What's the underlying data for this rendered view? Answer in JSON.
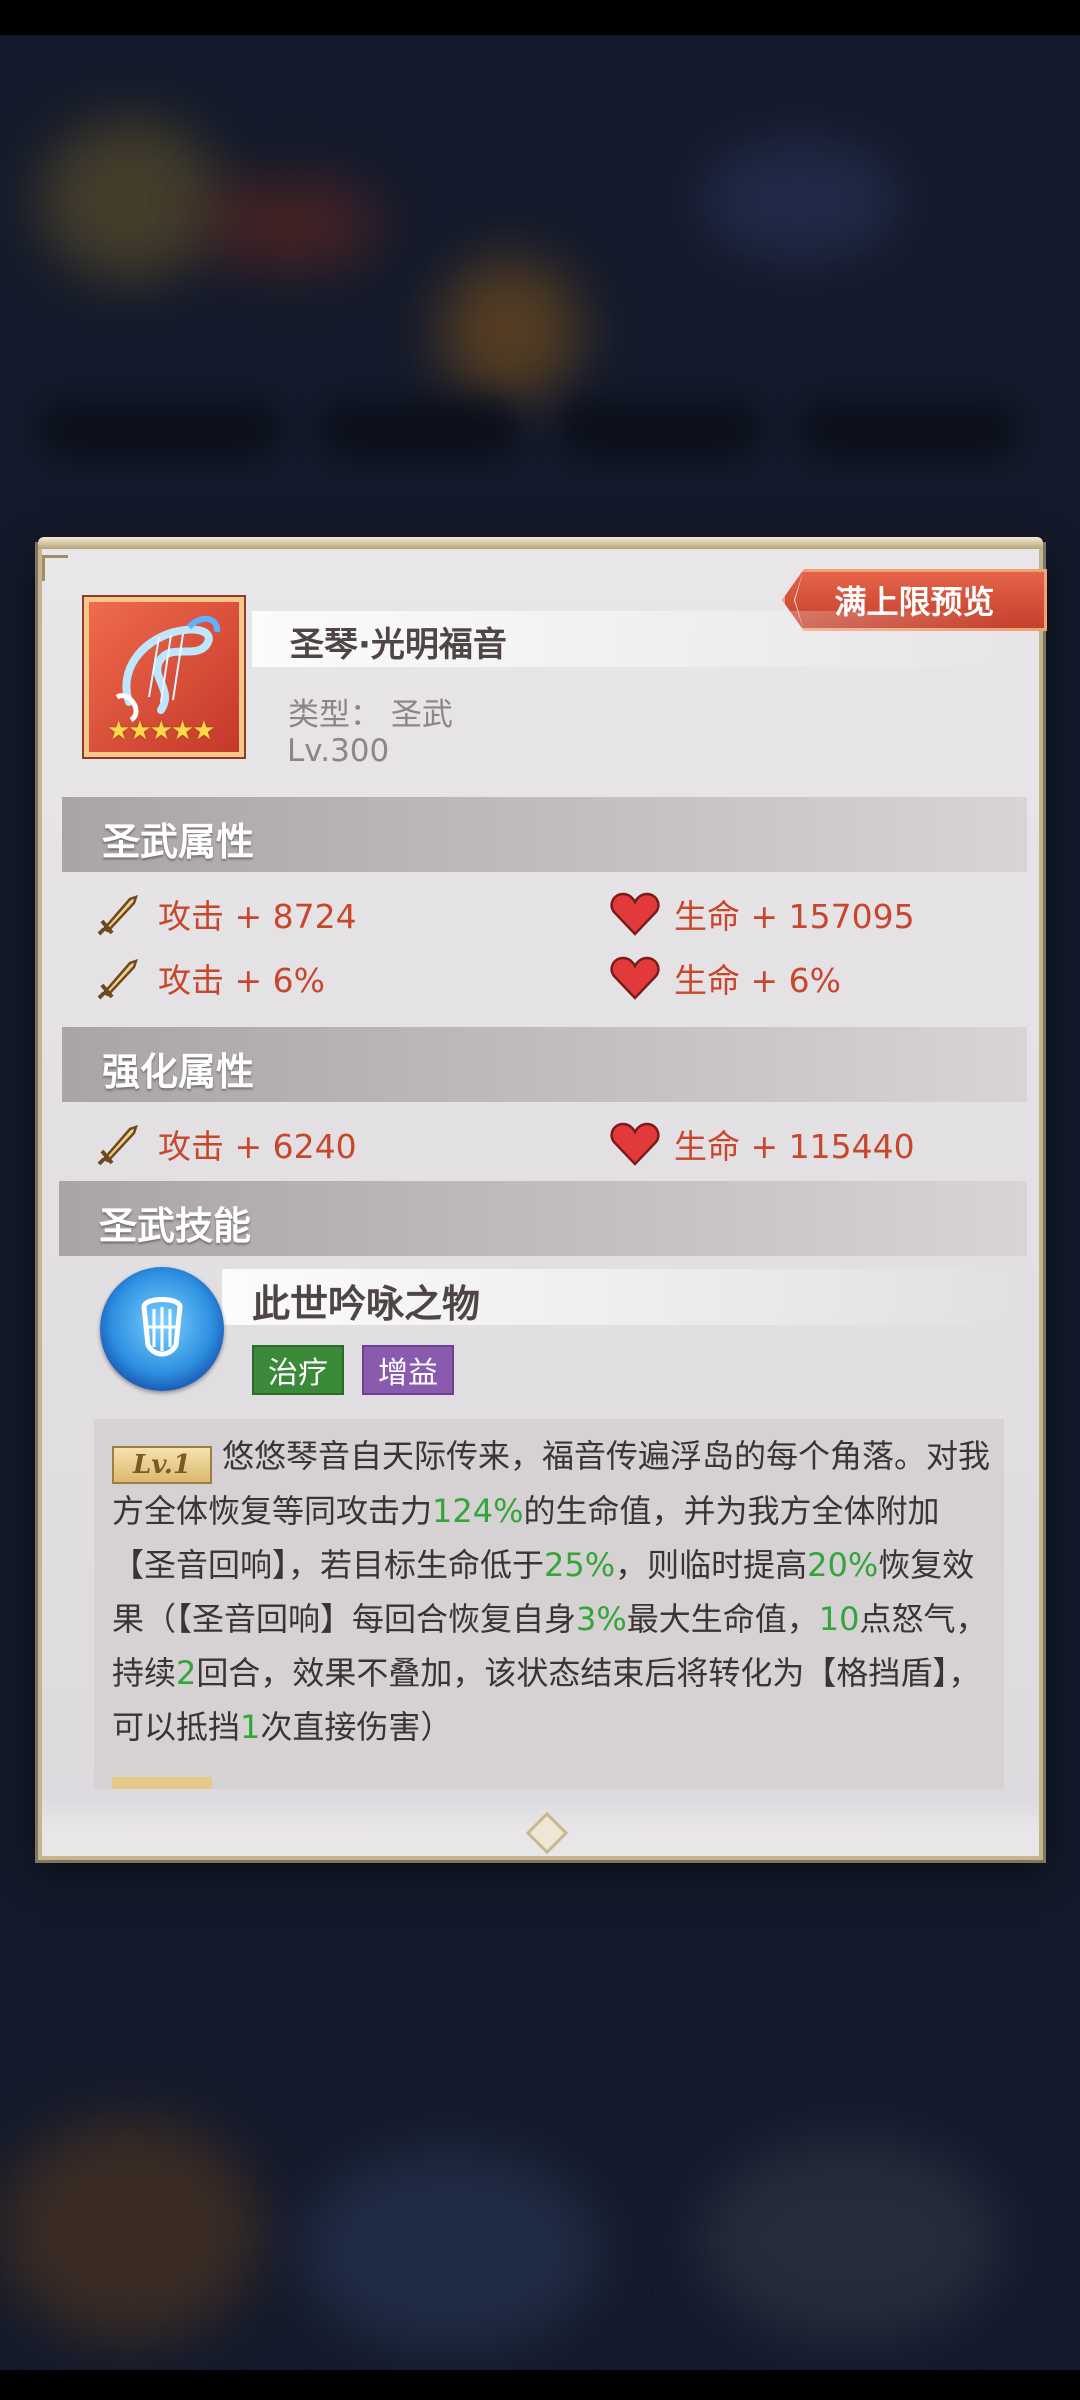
{
  "preview_button": "满上限预览",
  "item": {
    "name": "圣琴·光明福音",
    "type": "类型：  圣武",
    "level": "Lv.300",
    "stars": "★★★★★"
  },
  "sections": {
    "base_title": "圣武属性",
    "enhance_title": "强化属性",
    "skill_title": "圣武技能"
  },
  "base_stats": [
    {
      "label": "攻击 + 8724",
      "icon": "sword-icon"
    },
    {
      "label": "生命 + 157095",
      "icon": "heart-icon"
    },
    {
      "label": "攻击 + 6%",
      "icon": "sword-icon"
    },
    {
      "label": "生命 + 6%",
      "icon": "heart-icon"
    }
  ],
  "enhance_stats": [
    {
      "label": "攻击 + 6240",
      "icon": "sword-icon"
    },
    {
      "label": "生命 + 115440",
      "icon": "heart-icon"
    }
  ],
  "skill": {
    "name": "此世吟咏之物",
    "tags": [
      "治疗",
      "增益"
    ],
    "level_badge": "Lv.1",
    "desc": {
      "p1": "悠悠琴音自天际传来，福音传遍浮岛的每个角落。对我方全体恢复等同攻击力",
      "v1": "124%",
      "p2": "的生命值，并为我方全体附加【圣音回响】，若目标生命低于",
      "v2": "25%",
      "p3": "，则临时提高",
      "v3": "20%",
      "p4": "恢复效果（【圣音回响】每回合恢复自身",
      "v4": "3%",
      "p5": "最大生命值，",
      "v5": "10",
      "p6": "点怒气，持续",
      "v6": "2",
      "p7": "回合，效果不叠加，该状态结束后将转化为【格挡盾】，可以抵挡",
      "v7": "1",
      "p8": "次直接伤害）"
    }
  },
  "colors": {
    "stat_text": "#c8472c",
    "highlight": "#33a63a",
    "preview_button": "#d24f37",
    "tag_heal": "#3b8a3a",
    "tag_buff": "#8a5aaf"
  }
}
